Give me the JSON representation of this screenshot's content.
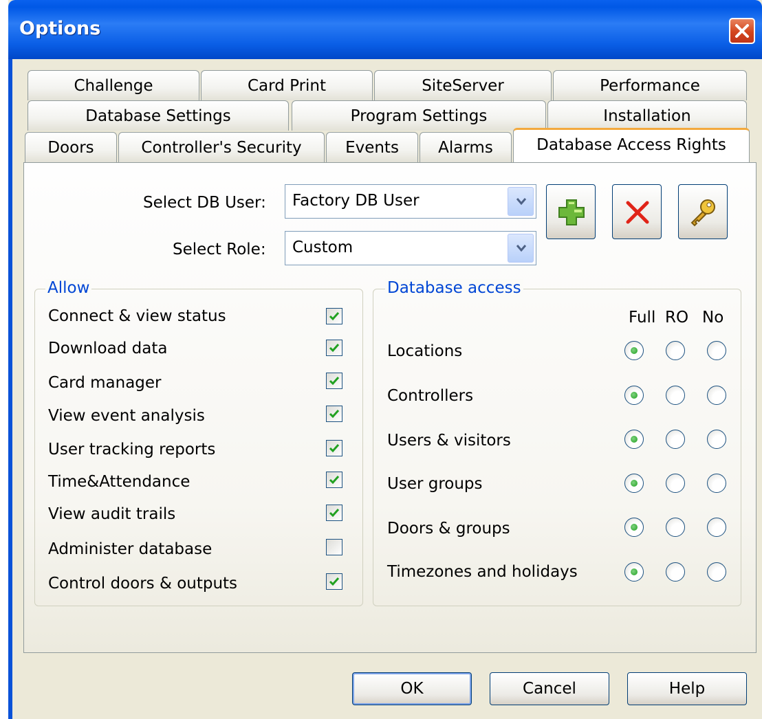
{
  "window": {
    "title": "Options"
  },
  "tabs": {
    "row1": [
      "Challenge",
      "Card Print",
      "SiteServer",
      "Performance"
    ],
    "row2": [
      "Database Settings",
      "Program Settings",
      "Installation"
    ],
    "row3": [
      "Doors",
      "Controller's Security",
      "Events",
      "Alarms",
      "Database Access Rights"
    ],
    "active": "Database Access Rights"
  },
  "user": {
    "label": "Select DB User:",
    "value": "Factory DB User"
  },
  "role": {
    "label": "Select Role:",
    "value": "Custom"
  },
  "toolbar": {
    "icons": [
      "add-user-icon",
      "delete-user-icon",
      "password-key-icon"
    ]
  },
  "allow": {
    "title": "Allow",
    "items": [
      {
        "label": "Connect & view status",
        "checked": true
      },
      {
        "label": "Download data",
        "checked": true
      },
      {
        "label": "Card manager",
        "checked": true
      },
      {
        "label": "View event analysis",
        "checked": true
      },
      {
        "label": "User tracking reports",
        "checked": true
      },
      {
        "label": "Time&Attendance",
        "checked": true
      },
      {
        "label": "View audit trails",
        "checked": true
      },
      {
        "label": "Administer database",
        "checked": false
      },
      {
        "label": "Control doors & outputs",
        "checked": true
      }
    ]
  },
  "dbaccess": {
    "title": "Database access",
    "columns": [
      "Full",
      "RO",
      "No"
    ],
    "rows": [
      {
        "label": "Locations",
        "selected": "Full"
      },
      {
        "label": "Controllers",
        "selected": "Full"
      },
      {
        "label": "Users & visitors",
        "selected": "Full"
      },
      {
        "label": "User groups",
        "selected": "Full"
      },
      {
        "label": "Doors & groups",
        "selected": "Full"
      },
      {
        "label": "Timezones and holidays",
        "selected": "Full"
      }
    ]
  },
  "buttons": {
    "ok": "OK",
    "cancel": "Cancel",
    "help": "Help"
  }
}
